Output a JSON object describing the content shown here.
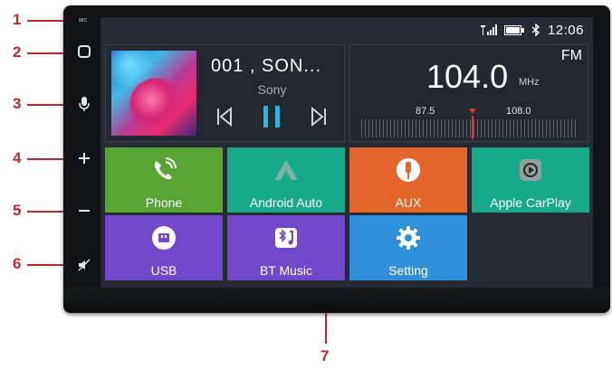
{
  "callouts": [
    "1",
    "2",
    "3",
    "4",
    "5",
    "6",
    "7"
  ],
  "device": {
    "mic_label": "MIC",
    "side_buttons": [
      "home-icon",
      "microphone-icon",
      "plus-icon",
      "minus-icon",
      "mute-icon"
    ]
  },
  "status_bar": {
    "icons": [
      "signal-icon",
      "battery-icon",
      "bluetooth-icon"
    ],
    "time": "12:06"
  },
  "media_player": {
    "track": "001 , SON...",
    "artist": "Sony",
    "controls": [
      "previous-icon",
      "pause-icon",
      "next-icon"
    ]
  },
  "radio": {
    "band": "FM",
    "frequency": "104.0",
    "unit": "MHz",
    "scale_min": "87.5",
    "scale_max": "108.0"
  },
  "apps": [
    {
      "label": "Phone",
      "color": "#58a534",
      "icon": "phone-icon"
    },
    {
      "label": "Android Auto",
      "color": "#16a98a",
      "icon": "android-auto-icon"
    },
    {
      "label": "AUX",
      "color": "#e3672a",
      "icon": "aux-icon"
    },
    {
      "label": "Apple CarPlay",
      "color": "#16a98a",
      "icon": "carplay-icon"
    },
    {
      "label": "USB",
      "color": "#7347c9",
      "icon": "usb-icon"
    },
    {
      "label": "BT Music",
      "color": "#7347c9",
      "icon": "bt-music-icon"
    },
    {
      "label": "Setting",
      "color": "#2f8fd8",
      "icon": "gear-icon"
    }
  ]
}
